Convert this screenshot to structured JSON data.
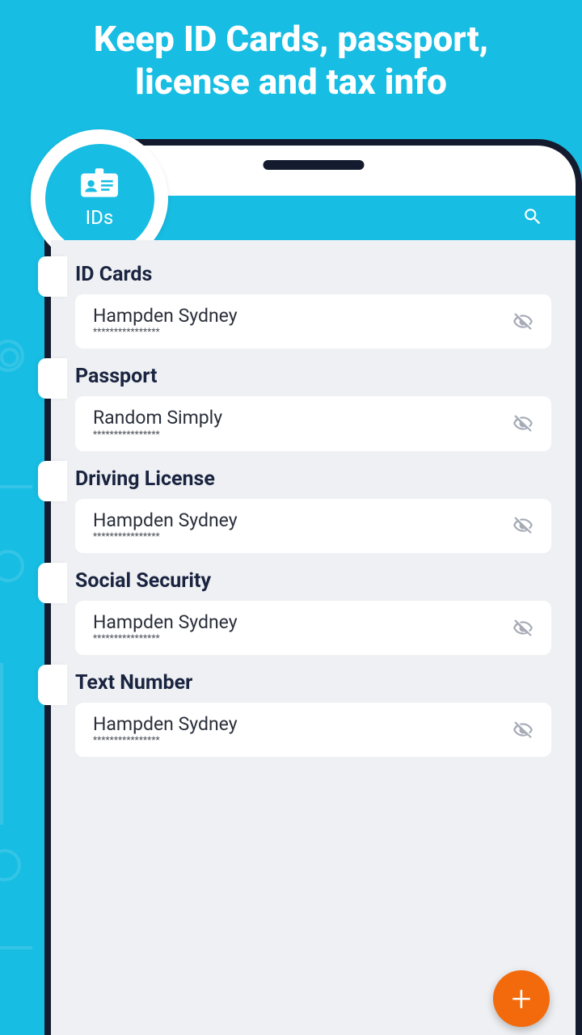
{
  "headline": "Keep ID Cards, passport, license and tax info",
  "badge": {
    "label": "IDs"
  },
  "sections": [
    {
      "label": "ID Cards",
      "item": {
        "name": "Hampden Sydney",
        "masked": "****************"
      }
    },
    {
      "label": "Passport",
      "item": {
        "name": "Random Simply",
        "masked": "****************"
      }
    },
    {
      "label": "Driving License",
      "item": {
        "name": "Hampden Sydney",
        "masked": "****************"
      }
    },
    {
      "label": "Social Security",
      "item": {
        "name": "Hampden Sydney",
        "masked": "****************"
      }
    },
    {
      "label": "Text Number",
      "item": {
        "name": "Hampden Sydney",
        "masked": "****************"
      }
    }
  ],
  "fab": {
    "glyph": "+"
  }
}
